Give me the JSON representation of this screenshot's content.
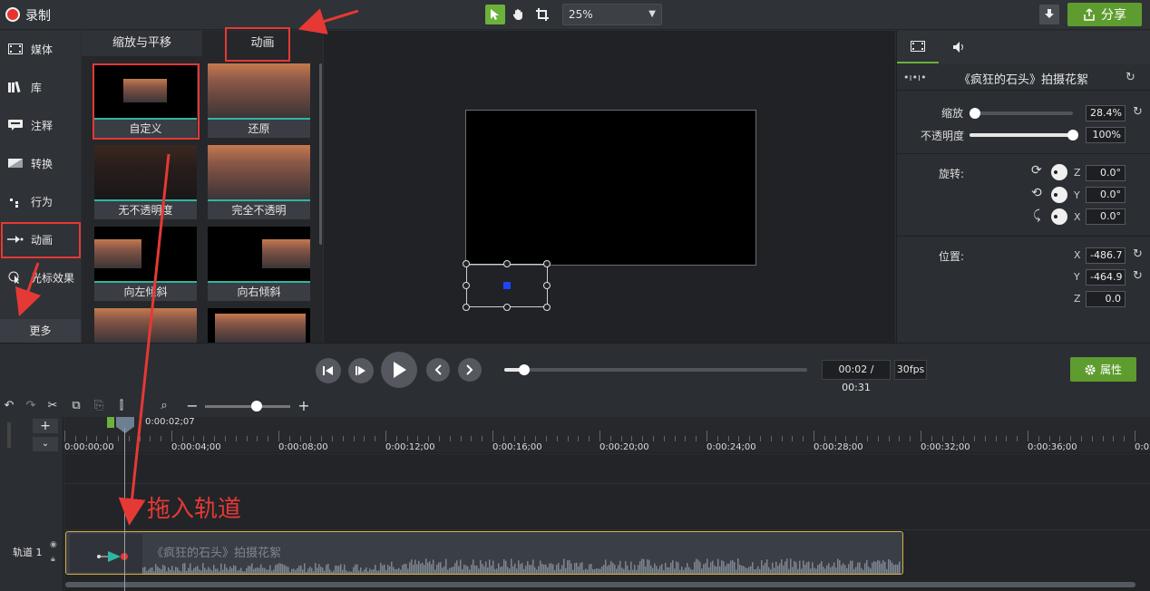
{
  "app": {
    "record_label": "录制",
    "zoom_value": "25%",
    "share_label": "分享"
  },
  "leftnav": {
    "items": [
      {
        "label": "媒体",
        "icon": "film-icon"
      },
      {
        "label": "库",
        "icon": "library-icon"
      },
      {
        "label": "注释",
        "icon": "annotation-icon"
      },
      {
        "label": "转换",
        "icon": "transition-icon"
      },
      {
        "label": "行为",
        "icon": "behavior-icon"
      },
      {
        "label": "动画",
        "icon": "animation-icon"
      },
      {
        "label": "光标效果",
        "icon": "cursor-effect-icon"
      }
    ],
    "more_label": "更多"
  },
  "library": {
    "tabs": [
      "缩放与平移",
      "动画"
    ],
    "active_tab": "动画",
    "thumbnails": [
      "自定义",
      "还原",
      "无不透明度",
      "完全不透明",
      "向左倾斜",
      "向右倾斜"
    ]
  },
  "properties": {
    "clip_title": "《疯狂的石头》拍摄花絮",
    "scale_label": "缩放",
    "scale_value": "28.4%",
    "scale_level": 0.05,
    "opacity_label": "不透明度",
    "opacity_value": "100%",
    "opacity_level": 1.0,
    "rotation_label": "旋转:",
    "rot_z_label": "Z",
    "rot_z": "0.0°",
    "rot_y_label": "Y",
    "rot_y": "0.0°",
    "rot_x_label": "X",
    "rot_x": "0.0°",
    "position_label": "位置:",
    "pos_x_label": "X",
    "pos_x": "-486.7",
    "pos_y_label": "Y",
    "pos_y": "-464.9",
    "pos_z_label": "Z",
    "pos_z": "0.0"
  },
  "playback": {
    "time": "00:02 / 00:31",
    "fps": "30fps",
    "properties_label": "属性",
    "progress": 0.065
  },
  "timeline": {
    "playhead_time": "0:00:02;07",
    "ruler_labels": [
      "0:00:00;00",
      "0:00:04;00",
      "0:00:08;00",
      "0:00:12;00",
      "0:00:16;00",
      "0:00:20;00",
      "0:00:24;00",
      "0:00:28;00",
      "0:00:32;00",
      "0:00:36;00",
      "0:0"
    ],
    "track_label": "轨道 1",
    "clip_title": "《疯狂的石头》拍摄花絮"
  },
  "annotation": {
    "text": "拖入轨道"
  },
  "colors": {
    "accent_green": "#5f9c2f",
    "annotation_red": "#e53935",
    "teal": "#2fb6a3"
  }
}
